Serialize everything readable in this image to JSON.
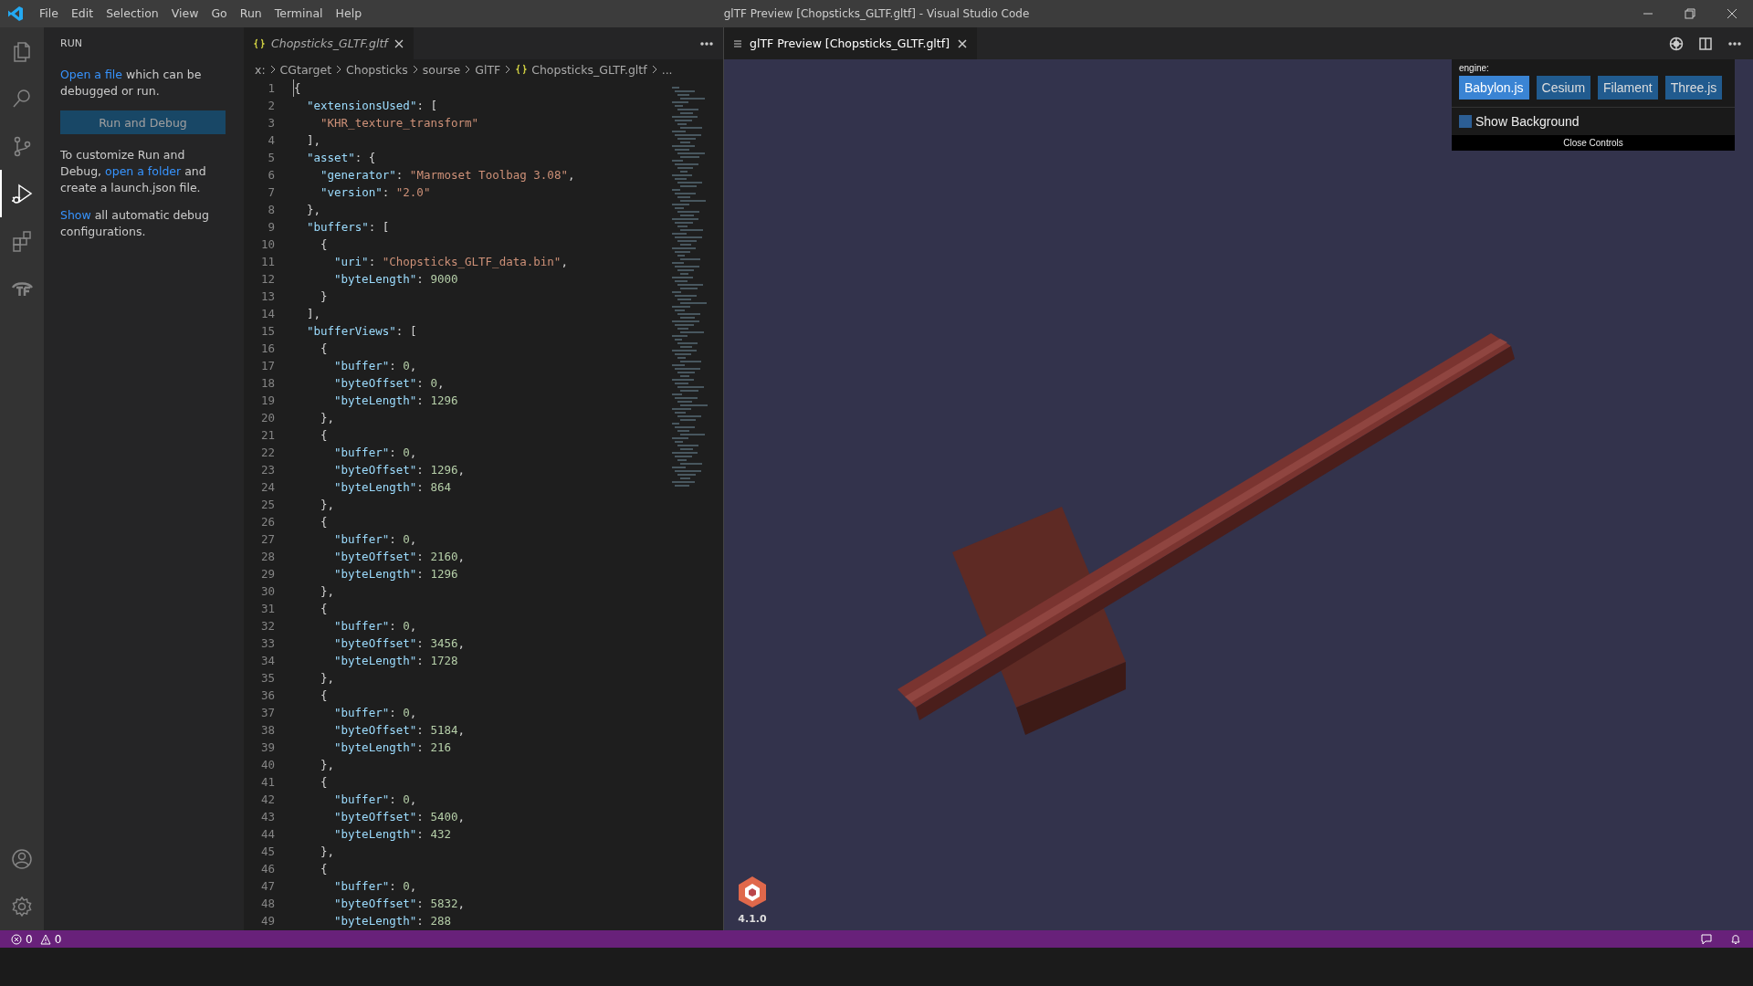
{
  "window": {
    "title": "glTF Preview [Chopsticks_GLTF.gltf] - Visual Studio Code",
    "menu": [
      "File",
      "Edit",
      "Selection",
      "View",
      "Go",
      "Run",
      "Terminal",
      "Help"
    ]
  },
  "activity_bar": {
    "items": [
      {
        "kind": "files",
        "selected": false
      },
      {
        "kind": "search",
        "selected": false
      },
      {
        "kind": "source-control",
        "selected": false
      },
      {
        "kind": "run-debug",
        "selected": true
      },
      {
        "kind": "extensions",
        "selected": false
      },
      {
        "kind": "tf",
        "selected": false
      }
    ],
    "bottom": [
      {
        "kind": "account"
      },
      {
        "kind": "settings"
      }
    ]
  },
  "sidebar": {
    "title": "RUN",
    "paragraphs": [
      {
        "kind": "text",
        "text": "which can be debugged or run.",
        "link": "Open a file"
      },
      {
        "kind": "button",
        "text": "Run and Debug"
      },
      {
        "kind": "text2",
        "before": "To customize Run and Debug,",
        "link": "open a folder",
        "after": "and create a launch.json file."
      },
      {
        "kind": "text",
        "text": "all automatic debug configurations.",
        "link": "Show"
      }
    ]
  },
  "editor": {
    "tab": {
      "label": "Chopsticks_GLTF.gltf",
      "preview": true
    },
    "breadcrumbs": [
      "x:",
      "CGtarget",
      "Chopsticks",
      "sourse",
      "GlTF",
      "Chopsticks_GLTF.gltf",
      "..."
    ],
    "lines": [
      {
        "number": "1",
        "tokens": [
          {
            "kind": "punct",
            "text": "{"
          }
        ]
      },
      {
        "number": "2",
        "tokens": [
          {
            "kind": "key",
            "text": "\"extensionsUsed\""
          },
          {
            "kind": "punct",
            "text": ": ["
          }
        ]
      },
      {
        "number": "3",
        "tokens": [
          {
            "kind": "string",
            "text": "\"KHR_texture_transform\""
          }
        ]
      },
      {
        "number": "4",
        "tokens": [
          {
            "kind": "punct",
            "text": "],"
          }
        ]
      },
      {
        "number": "5",
        "tokens": [
          {
            "kind": "key",
            "text": "\"asset\""
          },
          {
            "kind": "punct",
            "text": ": {"
          }
        ]
      },
      {
        "number": "6",
        "tokens": [
          {
            "kind": "key",
            "text": "\"generator\""
          },
          {
            "kind": "punct",
            "text": ": "
          },
          {
            "kind": "string",
            "text": "\"Marmoset Toolbag 3.08\""
          },
          {
            "kind": "punct",
            "text": ","
          }
        ]
      },
      {
        "number": "7",
        "tokens": [
          {
            "kind": "key",
            "text": "\"version\""
          },
          {
            "kind": "punct",
            "text": ": "
          },
          {
            "kind": "string",
            "text": "\"2.0\""
          }
        ]
      },
      {
        "number": "8",
        "tokens": [
          {
            "kind": "punct",
            "text": "},"
          }
        ]
      },
      {
        "number": "9",
        "tokens": [
          {
            "kind": "key",
            "text": "\"buffers\""
          },
          {
            "kind": "punct",
            "text": ": ["
          }
        ]
      },
      {
        "number": "10",
        "tokens": [
          {
            "kind": "punct",
            "text": "{"
          }
        ]
      },
      {
        "number": "11",
        "tokens": [
          {
            "kind": "key",
            "text": "\"uri\""
          },
          {
            "kind": "punct",
            "text": ": "
          },
          {
            "kind": "string",
            "text": "\"Chopsticks_GLTF_data.bin\""
          },
          {
            "kind": "punct",
            "text": ","
          }
        ]
      },
      {
        "number": "12",
        "tokens": [
          {
            "kind": "key",
            "text": "\"byteLength\""
          },
          {
            "kind": "punct",
            "text": ": "
          },
          {
            "kind": "number",
            "text": "9000"
          }
        ]
      },
      {
        "number": "13",
        "tokens": [
          {
            "kind": "punct",
            "text": "}"
          }
        ]
      },
      {
        "number": "14",
        "tokens": [
          {
            "kind": "punct",
            "text": "],"
          }
        ]
      },
      {
        "number": "15",
        "tokens": [
          {
            "kind": "key",
            "text": "\"bufferViews\""
          },
          {
            "kind": "punct",
            "text": ": ["
          }
        ]
      },
      {
        "number": "16",
        "tokens": [
          {
            "kind": "punct",
            "text": "{"
          }
        ]
      },
      {
        "number": "17",
        "tokens": [
          {
            "kind": "key",
            "text": "\"buffer\""
          },
          {
            "kind": "punct",
            "text": ": "
          },
          {
            "kind": "number",
            "text": "0"
          },
          {
            "kind": "punct",
            "text": ","
          }
        ]
      },
      {
        "number": "18",
        "tokens": [
          {
            "kind": "key",
            "text": "\"byteOffset\""
          },
          {
            "kind": "punct",
            "text": ": "
          },
          {
            "kind": "number",
            "text": "0"
          },
          {
            "kind": "punct",
            "text": ","
          }
        ]
      },
      {
        "number": "19",
        "tokens": [
          {
            "kind": "key",
            "text": "\"byteLength\""
          },
          {
            "kind": "punct",
            "text": ": "
          },
          {
            "kind": "number",
            "text": "1296"
          }
        ]
      },
      {
        "number": "20",
        "tokens": [
          {
            "kind": "punct",
            "text": "},"
          }
        ]
      },
      {
        "number": "21",
        "tokens": [
          {
            "kind": "punct",
            "text": "{"
          }
        ]
      },
      {
        "number": "22",
        "tokens": [
          {
            "kind": "key",
            "text": "\"buffer\""
          },
          {
            "kind": "punct",
            "text": ": "
          },
          {
            "kind": "number",
            "text": "0"
          },
          {
            "kind": "punct",
            "text": ","
          }
        ]
      },
      {
        "number": "23",
        "tokens": [
          {
            "kind": "key",
            "text": "\"byteOffset\""
          },
          {
            "kind": "punct",
            "text": ": "
          },
          {
            "kind": "number",
            "text": "1296"
          },
          {
            "kind": "punct",
            "text": ","
          }
        ]
      },
      {
        "number": "24",
        "tokens": [
          {
            "kind": "key",
            "text": "\"byteLength\""
          },
          {
            "kind": "punct",
            "text": ": "
          },
          {
            "kind": "number",
            "text": "864"
          }
        ]
      },
      {
        "number": "25",
        "tokens": [
          {
            "kind": "punct",
            "text": "},"
          }
        ]
      },
      {
        "number": "26",
        "tokens": [
          {
            "kind": "punct",
            "text": "{"
          }
        ]
      },
      {
        "number": "27",
        "tokens": [
          {
            "kind": "key",
            "text": "\"buffer\""
          },
          {
            "kind": "punct",
            "text": ": "
          },
          {
            "kind": "number",
            "text": "0"
          },
          {
            "kind": "punct",
            "text": ","
          }
        ]
      },
      {
        "number": "28",
        "tokens": [
          {
            "kind": "key",
            "text": "\"byteOffset\""
          },
          {
            "kind": "punct",
            "text": ": "
          },
          {
            "kind": "number",
            "text": "2160"
          },
          {
            "kind": "punct",
            "text": ","
          }
        ]
      },
      {
        "number": "29",
        "tokens": [
          {
            "kind": "key",
            "text": "\"byteLength\""
          },
          {
            "kind": "punct",
            "text": ": "
          },
          {
            "kind": "number",
            "text": "1296"
          }
        ]
      },
      {
        "number": "30",
        "tokens": [
          {
            "kind": "punct",
            "text": "},"
          }
        ]
      },
      {
        "number": "31",
        "tokens": [
          {
            "kind": "punct",
            "text": "{"
          }
        ]
      },
      {
        "number": "32",
        "tokens": [
          {
            "kind": "key",
            "text": "\"buffer\""
          },
          {
            "kind": "punct",
            "text": ": "
          },
          {
            "kind": "number",
            "text": "0"
          },
          {
            "kind": "punct",
            "text": ","
          }
        ]
      },
      {
        "number": "33",
        "tokens": [
          {
            "kind": "key",
            "text": "\"byteOffset\""
          },
          {
            "kind": "punct",
            "text": ": "
          },
          {
            "kind": "number",
            "text": "3456"
          },
          {
            "kind": "punct",
            "text": ","
          }
        ]
      },
      {
        "number": "34",
        "tokens": [
          {
            "kind": "key",
            "text": "\"byteLength\""
          },
          {
            "kind": "punct",
            "text": ": "
          },
          {
            "kind": "number",
            "text": "1728"
          }
        ]
      },
      {
        "number": "35",
        "tokens": [
          {
            "kind": "punct",
            "text": "},"
          }
        ]
      },
      {
        "number": "36",
        "tokens": [
          {
            "kind": "punct",
            "text": "{"
          }
        ]
      },
      {
        "number": "37",
        "tokens": [
          {
            "kind": "key",
            "text": "\"buffer\""
          },
          {
            "kind": "punct",
            "text": ": "
          },
          {
            "kind": "number",
            "text": "0"
          },
          {
            "kind": "punct",
            "text": ","
          }
        ]
      },
      {
        "number": "38",
        "tokens": [
          {
            "kind": "key",
            "text": "\"byteOffset\""
          },
          {
            "kind": "punct",
            "text": ": "
          },
          {
            "kind": "number",
            "text": "5184"
          },
          {
            "kind": "punct",
            "text": ","
          }
        ]
      },
      {
        "number": "39",
        "tokens": [
          {
            "kind": "key",
            "text": "\"byteLength\""
          },
          {
            "kind": "punct",
            "text": ": "
          },
          {
            "kind": "number",
            "text": "216"
          }
        ]
      },
      {
        "number": "40",
        "tokens": [
          {
            "kind": "punct",
            "text": "},"
          }
        ]
      },
      {
        "number": "41",
        "tokens": [
          {
            "kind": "punct",
            "text": "{"
          }
        ]
      },
      {
        "number": "42",
        "tokens": [
          {
            "kind": "key",
            "text": "\"buffer\""
          },
          {
            "kind": "punct",
            "text": ": "
          },
          {
            "kind": "number",
            "text": "0"
          },
          {
            "kind": "punct",
            "text": ","
          }
        ]
      },
      {
        "number": "43",
        "tokens": [
          {
            "kind": "key",
            "text": "\"byteOffset\""
          },
          {
            "kind": "punct",
            "text": ": "
          },
          {
            "kind": "number",
            "text": "5400"
          },
          {
            "kind": "punct",
            "text": ","
          }
        ]
      },
      {
        "number": "44",
        "tokens": [
          {
            "kind": "key",
            "text": "\"byteLength\""
          },
          {
            "kind": "punct",
            "text": ": "
          },
          {
            "kind": "number",
            "text": "432"
          }
        ]
      },
      {
        "number": "45",
        "tokens": [
          {
            "kind": "punct",
            "text": "},"
          }
        ]
      },
      {
        "number": "46",
        "tokens": [
          {
            "kind": "punct",
            "text": "{"
          }
        ]
      },
      {
        "number": "47",
        "tokens": [
          {
            "kind": "key",
            "text": "\"buffer\""
          },
          {
            "kind": "punct",
            "text": ": "
          },
          {
            "kind": "number",
            "text": "0"
          },
          {
            "kind": "punct",
            "text": ","
          }
        ]
      },
      {
        "number": "48",
        "tokens": [
          {
            "kind": "key",
            "text": "\"byteOffset\""
          },
          {
            "kind": "punct",
            "text": ": "
          },
          {
            "kind": "number",
            "text": "5832"
          },
          {
            "kind": "punct",
            "text": ","
          }
        ]
      },
      {
        "number": "49",
        "tokens": [
          {
            "kind": "key",
            "text": "\"byteLength\""
          },
          {
            "kind": "punct",
            "text": ": "
          },
          {
            "kind": "number",
            "text": "288"
          }
        ]
      }
    ]
  },
  "preview": {
    "tab": {
      "label": "glTF Preview [Chopsticks_GLTF.gltf]"
    },
    "controls": {
      "engine_label": "engine:",
      "engines": [
        {
          "label": "Babylon.js",
          "selected": true
        },
        {
          "label": "Cesium",
          "selected": false
        },
        {
          "label": "Filament",
          "selected": false
        },
        {
          "label": "Three.js",
          "selected": false
        }
      ],
      "show_background": {
        "label": "Show Background",
        "checked": false
      },
      "close": "Close Controls"
    },
    "version": "4.1.0"
  },
  "status_bar": {
    "errors": "0",
    "warnings": "0"
  }
}
